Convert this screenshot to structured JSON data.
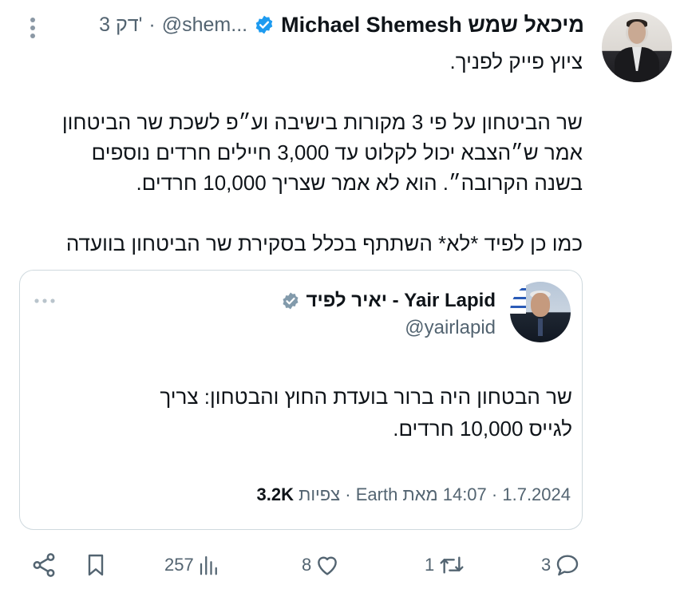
{
  "author": {
    "name": "Michael Shemesh מיכאל שמש",
    "handle": "@shem...",
    "time": "3 דק'",
    "separator": "·"
  },
  "tweet": {
    "lines": [
      "ציוץ פייק לפניך.",
      "",
      "שר הביטחון על פי 3 מקורות בישיבה וע״פ לשכת שר הביטחון",
      "אמר ש״הצבא יכול לקלוט עד 3,000 חיילים חרדים נוספים",
      "בשנה הקרובה״. הוא לא אמר שצריך 10,000 חרדים.",
      "",
      "כמו כן לפיד *לא* השתתף בכלל בסקירת שר הביטחון בוועדה"
    ]
  },
  "quote": {
    "name": "יאיר לפיד - Yair Lapid",
    "handle": "@yairlapid",
    "text_line1": "שר הבטחון היה ברור בועדת החוץ והבטחון: צריך",
    "text_line2": "לגייס 10,000 חרדים.",
    "date": "1.7.2024",
    "time": "14:07",
    "location": "מאת Earth",
    "views": "3.2K",
    "views_label": "צפיות",
    "separator": "·"
  },
  "actions": {
    "replies": "3",
    "retweets": "1",
    "likes": "8",
    "views": "257"
  },
  "colors": {
    "text": "#0f1419",
    "secondary": "#536471",
    "verified_blue": "#1d9bf0",
    "verified_gray": "#829aab",
    "border": "#cfd9de"
  }
}
